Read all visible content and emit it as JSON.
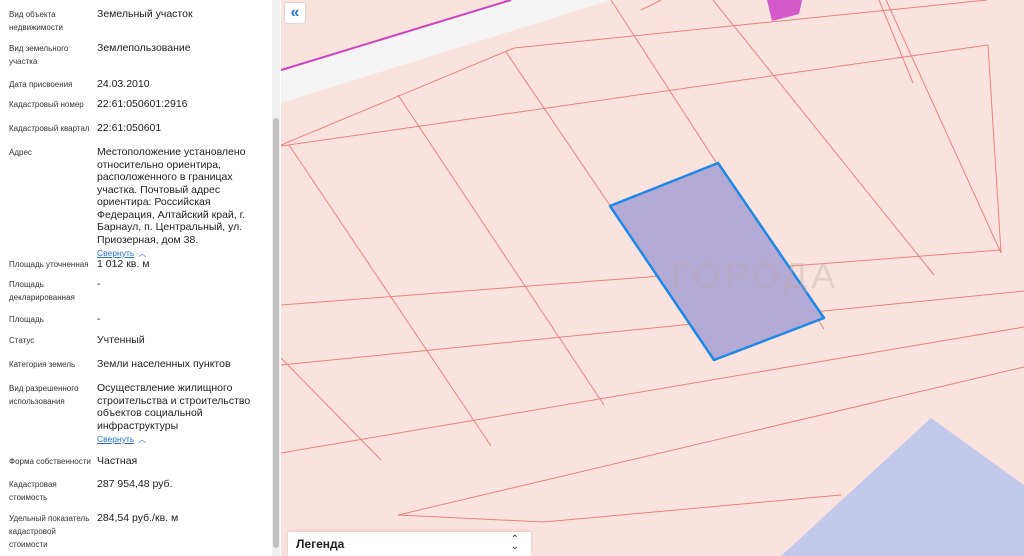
{
  "fields": [
    {
      "label": "Вид объекта недвижимости",
      "value": "Земельный участок"
    },
    {
      "label": "Вид земельного участка",
      "value": "Землепользование"
    },
    {
      "label": "Дата присвоения",
      "value": "24.03.2010"
    },
    {
      "label": "Кадастровый номер",
      "value": "22:61:050601:2916"
    },
    {
      "label": "Кадастровый квартал",
      "value": "22:61:050601"
    },
    {
      "label": "Адрес",
      "value": "Местоположение установлено относительно ориентира, расположенного в границах участка. Почтовый адрес ориентира: Российская Федерация, Алтайский край, г. Барнаул, п. Центральный, ул. Приозерная, дом 38.",
      "collapse": "Свернуть"
    },
    {
      "label": "Площадь уточненная",
      "value": "1 012 кв. м"
    },
    {
      "label": "Площадь декларированная",
      "value": "-"
    },
    {
      "label": "Площадь",
      "value": "-"
    },
    {
      "label": "Статус",
      "value": "Учтенный"
    },
    {
      "label": "Категория земель",
      "value": "Земли населенных пунктов"
    },
    {
      "label": "Вид разрешенного использования",
      "value": "Осуществление жилищного строительства и строительство объектов социальной инфраструктуры",
      "collapse": "Свернуть"
    },
    {
      "label": "Форма собственности",
      "value": "Частная"
    },
    {
      "label": "Кадастровая стоимость",
      "value": "287 954,48 руб."
    },
    {
      "label": "Удельный показатель кадастровой стоимости",
      "value": "284,54 руб./кв. м"
    }
  ],
  "panel_toggle_icon": "«",
  "legend": {
    "label": "Легенда",
    "arrow": "⌃⌄"
  },
  "watermark": "ГОРОДА",
  "colors": {
    "map_bg": "#fae3de",
    "parcel_line": "#e8847a",
    "selected_fill": "#b3aad6",
    "selected_stroke": "#1e88e5",
    "road": "#f4f4f4",
    "magenta_line": "#cc44bb",
    "water": "#c3c9ea"
  }
}
